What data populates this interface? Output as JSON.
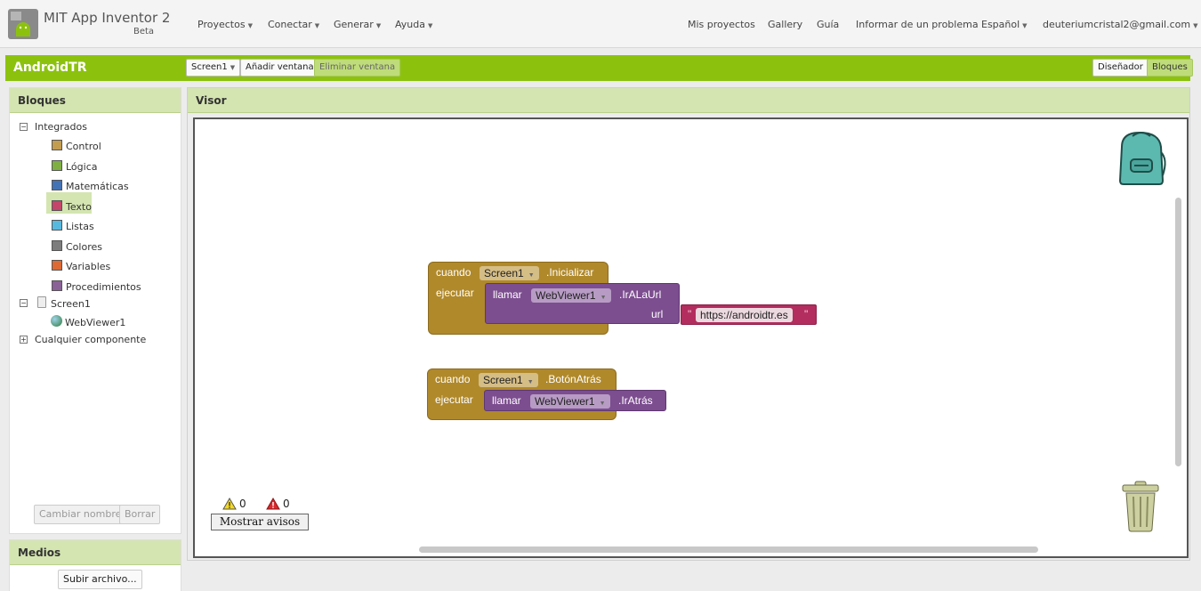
{
  "app": {
    "title": "MIT App Inventor 2",
    "badge": "Beta"
  },
  "nav_left": [
    {
      "label": "Proyectos"
    },
    {
      "label": "Conectar"
    },
    {
      "label": "Generar"
    },
    {
      "label": "Ayuda"
    }
  ],
  "nav_right": {
    "my_projects": "Mis proyectos",
    "gallery": "Gallery",
    "guide": "Guía",
    "report": "Informar de un problema",
    "language": "Español",
    "account": "deuteriumcristal2@gmail.com"
  },
  "project": {
    "name": "AndroidTR",
    "screen_select": "Screen1",
    "add_screen": "Añadir ventana",
    "remove_screen": "Eliminar ventana",
    "designer": "Diseñador",
    "blocks": "Bloques"
  },
  "blocks_panel": {
    "title": "Bloques",
    "builtin": "Integrados",
    "categories": [
      {
        "label": "Control",
        "color": "#c29c4f"
      },
      {
        "label": "Lógica",
        "color": "#7faf43"
      },
      {
        "label": "Matemáticas",
        "color": "#4373b5"
      },
      {
        "label": "Texto",
        "color": "#c5446a"
      },
      {
        "label": "Listas",
        "color": "#58b9df"
      },
      {
        "label": "Colores",
        "color": "#7d7d7d"
      },
      {
        "label": "Variables",
        "color": "#dd6a34"
      },
      {
        "label": "Procedimientos",
        "color": "#8a6297"
      }
    ],
    "screen": "Screen1",
    "component": "WebViewer1",
    "any_component": "Cualquier componente",
    "rename_button": "Cambiar nombre",
    "delete_button": "Borrar"
  },
  "media_panel": {
    "title": "Medios",
    "upload_button": "Subir archivo..."
  },
  "viewer": {
    "title": "Visor",
    "block1": {
      "when": "cuando",
      "component": "Screen1",
      "event": ".Inicializar",
      "do": "ejecutar",
      "call": "llamar",
      "target": "WebViewer1",
      "method": ".IrALaUrl",
      "param": "url",
      "quote_open": "\"",
      "quote_close": "\"",
      "value": "https://androidtr.es"
    },
    "block2": {
      "when": "cuando",
      "component": "Screen1",
      "event": ".BotónAtrás",
      "do": "ejecutar",
      "call": "llamar",
      "target": "WebViewer1",
      "method": ".IrAtrás"
    },
    "warnings": "0",
    "errors": "0",
    "show_warnings": "Mostrar avisos"
  },
  "colors": {
    "accent_green": "#8cc20e",
    "panel_header": "#d4e5b1"
  }
}
